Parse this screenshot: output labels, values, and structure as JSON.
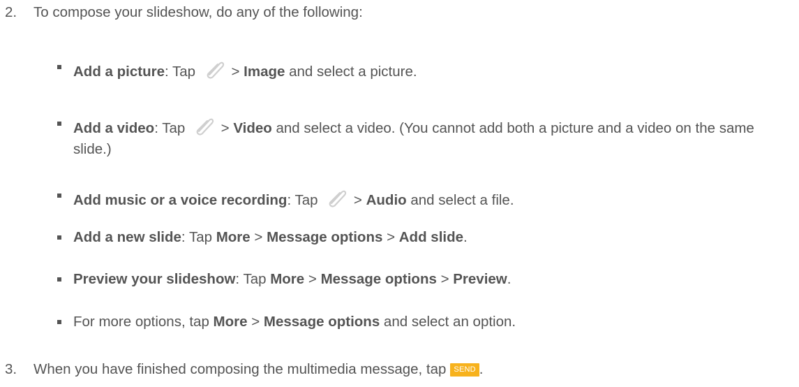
{
  "step2": {
    "number": "2.",
    "text": "To compose your slideshow, do any of the following:"
  },
  "bullets": [
    {
      "title": "Add a picture",
      "colon": ":",
      "tap": " Tap ",
      "icon": "paperclip-icon",
      "sep": " > ",
      "target": "Image",
      "rest": " and select a picture."
    },
    {
      "title": "Add a video",
      "colon": ":",
      "tap": " Tap ",
      "icon": "paperclip-icon",
      "sep": " > ",
      "target": "Video",
      "rest": " and select a video. (You cannot add both a picture and a video on the same slide.)"
    },
    {
      "title": "Add music or a voice recording",
      "colon": ":",
      "tap": " Tap ",
      "icon": "paperclip-icon",
      "sep": " > ",
      "target": "Audio",
      "rest": " and select a file."
    },
    {
      "title": "Add a new slide",
      "colon": ": Tap ",
      "more": "More",
      "sep1": " > ",
      "options": "Message options",
      "sep2": " > ",
      "target": "Add slide",
      "end": "."
    },
    {
      "title": "Preview your slideshow",
      "colon": ": Tap ",
      "more": "More",
      "sep1": " > ",
      "options": "Message options",
      "sep2": " > ",
      "target": "Preview",
      "end": "."
    },
    {
      "lead": "For more options, tap ",
      "more": "More",
      "sep1": " > ",
      "options": "Message options",
      "rest": " and select an option."
    }
  ],
  "step3": {
    "number": "3.",
    "text": "When you have finished composing the multimedia message, tap",
    "button_label": "SEND",
    "end": "."
  },
  "colors": {
    "text": "#545454",
    "send_button": "#f7b21d",
    "send_button_text": "#ffffff",
    "icon_stroke": "#cfcfcf"
  }
}
